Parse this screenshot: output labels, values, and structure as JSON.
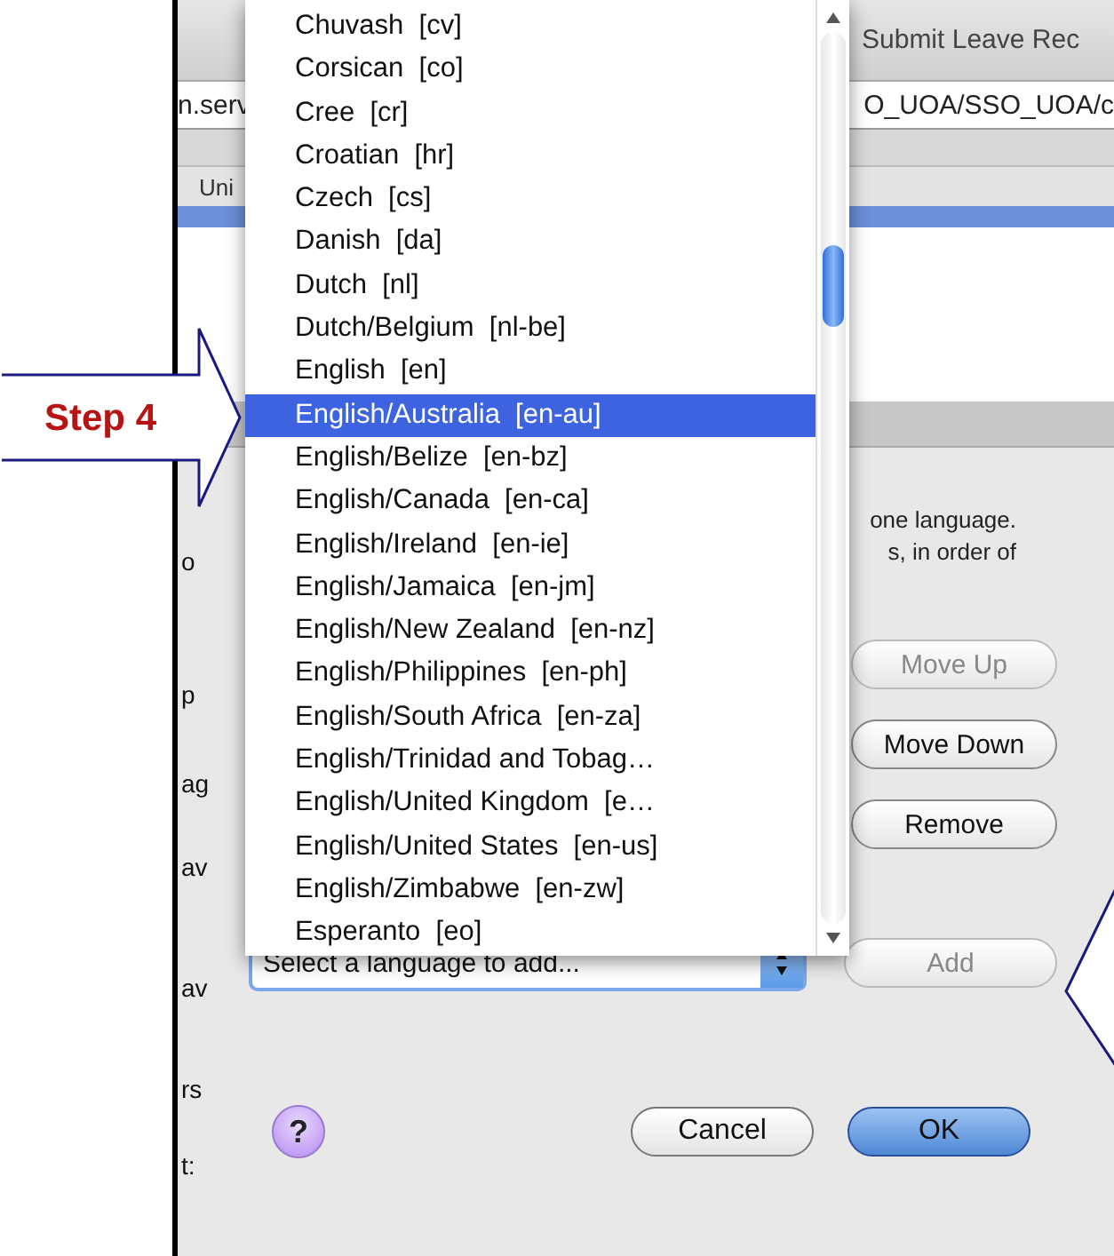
{
  "annotation": {
    "label": "Step 4"
  },
  "browser": {
    "title": "Submit Leave Rec",
    "url_start": "n.serv",
    "url_end": "O_UOA/SSO_UOA/c",
    "bookmark": "Uni"
  },
  "page_edge_text": [
    "o",
    "p",
    "ag",
    "av",
    "av",
    "rs",
    "t:"
  ],
  "dialog": {
    "description_fragments": [
      "one language.",
      "s, in order of"
    ],
    "language_list": {
      "items": [
        {
          "label": "Chuvash  [cv]",
          "selected": false
        },
        {
          "label": "Corsican  [co]",
          "selected": false
        },
        {
          "label": "Cree  [cr]",
          "selected": false
        },
        {
          "label": "Croatian  [hr]",
          "selected": false
        },
        {
          "label": "Czech  [cs]",
          "selected": false
        },
        {
          "label": "Danish  [da]",
          "selected": false
        },
        {
          "label": "Dutch  [nl]",
          "selected": false
        },
        {
          "label": "Dutch/Belgium  [nl-be]",
          "selected": false
        },
        {
          "label": "English  [en]",
          "selected": false
        },
        {
          "label": "English/Australia  [en-au]",
          "selected": true
        },
        {
          "label": "English/Belize  [en-bz]",
          "selected": false
        },
        {
          "label": "English/Canada  [en-ca]",
          "selected": false
        },
        {
          "label": "English/Ireland  [en-ie]",
          "selected": false
        },
        {
          "label": "English/Jamaica  [en-jm]",
          "selected": false
        },
        {
          "label": "English/New Zealand  [en-nz]",
          "selected": false
        },
        {
          "label": "English/Philippines  [en-ph]",
          "selected": false
        },
        {
          "label": "English/South Africa  [en-za]",
          "selected": false
        },
        {
          "label": "English/Trinidad and Tobag…",
          "selected": false
        },
        {
          "label": "English/United Kingdom  [e…",
          "selected": false
        },
        {
          "label": "English/United States  [en-us]",
          "selected": false
        },
        {
          "label": "English/Zimbabwe  [en-zw]",
          "selected": false
        },
        {
          "label": "Esperanto  [eo]",
          "selected": false
        }
      ]
    },
    "side_buttons": [
      {
        "label": "Move Up",
        "disabled": true
      },
      {
        "label": "Move Down",
        "disabled": false
      },
      {
        "label": "Remove",
        "disabled": false
      }
    ],
    "select": {
      "value": "Select a language to add..."
    },
    "add_button": {
      "label": "Add",
      "disabled": true
    },
    "help_button": {
      "label": "?"
    },
    "footer_buttons": [
      {
        "label": "Cancel",
        "default": false
      },
      {
        "label": "OK",
        "default": true
      }
    ]
  }
}
